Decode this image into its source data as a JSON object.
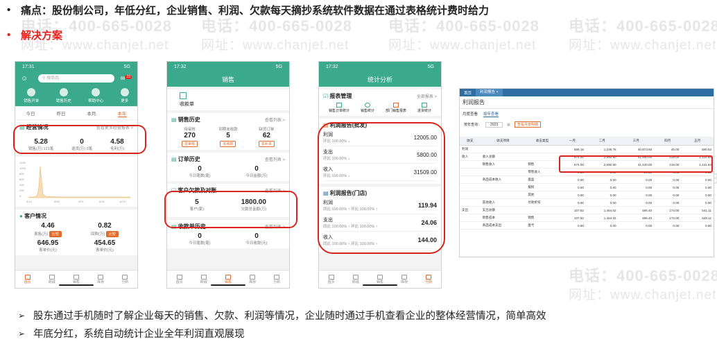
{
  "header": {
    "pain_label": "痛点：股份制公司，年低分红，企业销售、利润、欠款每天摘抄系统软件数据在通过表格统计费时给力",
    "solution_label": "解决方案",
    "bullet": "•"
  },
  "watermark": {
    "phone_text": "电话：400-665-0028",
    "site_text": "网址：www.chanjet.net"
  },
  "phone1": {
    "status_time": "17:31",
    "status_right": "5G",
    "search_placeholder": "搜商品",
    "badge": "23",
    "quick": [
      "销售开单",
      "销售历史",
      "帮助中心",
      "更多"
    ],
    "tabs": [
      "今日",
      "昨日",
      "本月",
      "本年"
    ],
    "ops_title": "经营情况",
    "ops_more": "查看更多经营报表 >",
    "ops_values": [
      {
        "value": "5.28",
        "label": "销售(万) 121笔"
      },
      {
        "value": "0",
        "label": "退货(万) 0笔"
      },
      {
        "value": "4.58",
        "label": "毛利(万)"
      }
    ],
    "chart_ticks_y": [
      "1200",
      "1000",
      "800",
      "600",
      "400",
      "200",
      "0"
    ],
    "chart_ticks_x": [
      "4/13",
      "5/05",
      "5/07",
      "6/16",
      "8/13"
    ],
    "cust_title": "客户情况",
    "cust_values": [
      {
        "value": "4.46",
        "label": "客售(万)",
        "tag": "比较"
      },
      {
        "value": "0.82",
        "label": "回购(万)",
        "tag": "比较"
      },
      {
        "value": "646.95",
        "label": "客单价(元)"
      },
      {
        "value": "454.65",
        "label": "客单价(元)"
      }
    ],
    "tabbar": [
      "首页",
      "商城",
      "销售",
      "库存",
      "分析"
    ]
  },
  "phone2": {
    "status_time": "17:32",
    "status_right": "5G",
    "title": "销售",
    "top_item": "收款单",
    "sales_title": "销售历史",
    "sales_more": "查看列表 >",
    "sales_values": [
      {
        "label": "待审核",
        "value": "270",
        "tag": "去审核"
      },
      {
        "label": "到期未收款",
        "value": "5",
        "tag": "去收款"
      },
      {
        "label": "缺货订单",
        "value": "62",
        "tag": "去补货"
      }
    ],
    "order_title": "订单历史",
    "order_more": "查看列表 >",
    "order_values": [
      {
        "value": "0",
        "label": "今日笔数(笔)"
      },
      {
        "value": "0",
        "label": "今日金额(万)"
      }
    ],
    "debt_title": "客户欠款及对账",
    "debt_more": "查看列表 >",
    "debt_values": [
      {
        "value": "5",
        "label": "客户(家)"
      },
      {
        "value": "1800.00",
        "label": "欠款总金额(万)"
      }
    ],
    "receipt_title": "收款单历史",
    "receipt_more": "查看列表 >",
    "receipt_values": [
      {
        "value": "0",
        "label": "今日笔数(笔)"
      },
      {
        "value": "0",
        "label": "今日收款(元)"
      }
    ],
    "tabbar": [
      "首页",
      "商城",
      "销售",
      "库存",
      "分析"
    ]
  },
  "phone3": {
    "status_time": "17:32",
    "status_right": "5G",
    "title": "统计分析",
    "mgmt_title": "报表管理",
    "mgmt_more": "全部报表 >",
    "mgmt_items": [
      "销售订单统计",
      "销售统计",
      "部门销售报表",
      "进货统计"
    ],
    "p1_title": "利润报告(批发)",
    "p1_rows": [
      {
        "name": "利润",
        "sub": "环比 100.00%",
        "dir": "↓",
        "value": "12005.00"
      },
      {
        "name": "支出",
        "sub": "环比 100.00%",
        "dir": "↓",
        "value": "5800.00"
      },
      {
        "name": "收入",
        "sub": "环比 100.00%",
        "dir": "↓",
        "value": "31509.00"
      }
    ],
    "p2_title": "利润报告(门店)",
    "p2_rows": [
      {
        "name": "利润",
        "sub": "同比 100.00%",
        "sub2": "环比 100.00%",
        "value": "119.94"
      },
      {
        "name": "支出",
        "sub": "同比 100.00%",
        "sub2": "环比 100.00%",
        "value": "24.06"
      },
      {
        "name": "收入",
        "sub": "同比 100.00%",
        "sub2": "环比 100.00%",
        "value": "144.00"
      }
    ],
    "tabbar": [
      "首页",
      "商城",
      "销售",
      "库存",
      "分析"
    ]
  },
  "report": {
    "top_tabs": [
      "首页",
      "利润报告 ×"
    ],
    "title": "利润报告",
    "sub_tabs": [
      "月度查看",
      "按年查看"
    ],
    "filter_label": "按年查询：",
    "filter_year": "2023",
    "filter_btn": "查看月度明细",
    "columns": [
      "收支",
      "收支项目",
      "收支类型",
      "一月",
      "二月",
      "三月",
      "四月",
      "五月"
    ],
    "rows": [
      [
        "利润",
        "",
        "",
        "666.16",
        "1,236.76",
        "40,873.60",
        "45.00",
        "590.53"
      ],
      [
        "收入",
        "收入总额",
        "",
        "674.00",
        "2,690.80",
        "41,460.00",
        "219.00",
        "1,131.64"
      ],
      [
        "",
        "销售收入",
        "销售",
        "674.00",
        "2,690.80",
        "41,440.00",
        "219.00",
        "1,131.64"
      ],
      [
        "",
        "",
        "零售收入",
        "0.00",
        "0.00",
        "20.00",
        "0.00",
        "0.00"
      ],
      [
        "",
        "商品成本收入",
        "盘盈",
        "0.00",
        "0.00",
        "0.00",
        "0.00",
        "0.00"
      ],
      [
        "",
        "",
        "报损",
        "0.00",
        "0.00",
        "0.00",
        "0.00",
        "0.00"
      ],
      [
        "",
        "",
        "其他",
        "0.00",
        "0.00",
        "0.00",
        "0.00",
        "0.00"
      ],
      [
        "",
        "其他收入",
        "付款折扣",
        "0.00",
        "0.00",
        "0.00",
        "0.00",
        "0.00"
      ],
      [
        "支出",
        "支出总额",
        "",
        "107.82",
        "1,454.02",
        "486.40",
        "174.00",
        "541.11"
      ],
      [
        "",
        "销售成本",
        "销售",
        "107.82",
        "1,454.02",
        "486.40",
        "174.00",
        "528.11"
      ],
      [
        "",
        "商品成本支出",
        "盘亏",
        "0.00",
        "0.00",
        "0.00",
        "0.00",
        "0.00"
      ]
    ]
  },
  "footer": {
    "arrow": "➢",
    "line1": "股东通过手机随时了解企业每天的销售、欠款、利润等情况，企业随时通过手机查看企业的整体经营情况，简单高效",
    "line2": "年底分红，系统自动统计企业全年利润直观展现"
  },
  "colors": {
    "accent_green": "#3aa98c",
    "highlight_red": "#d9241c",
    "orange": "#e06b2a",
    "report_blue": "#2f6da3"
  }
}
